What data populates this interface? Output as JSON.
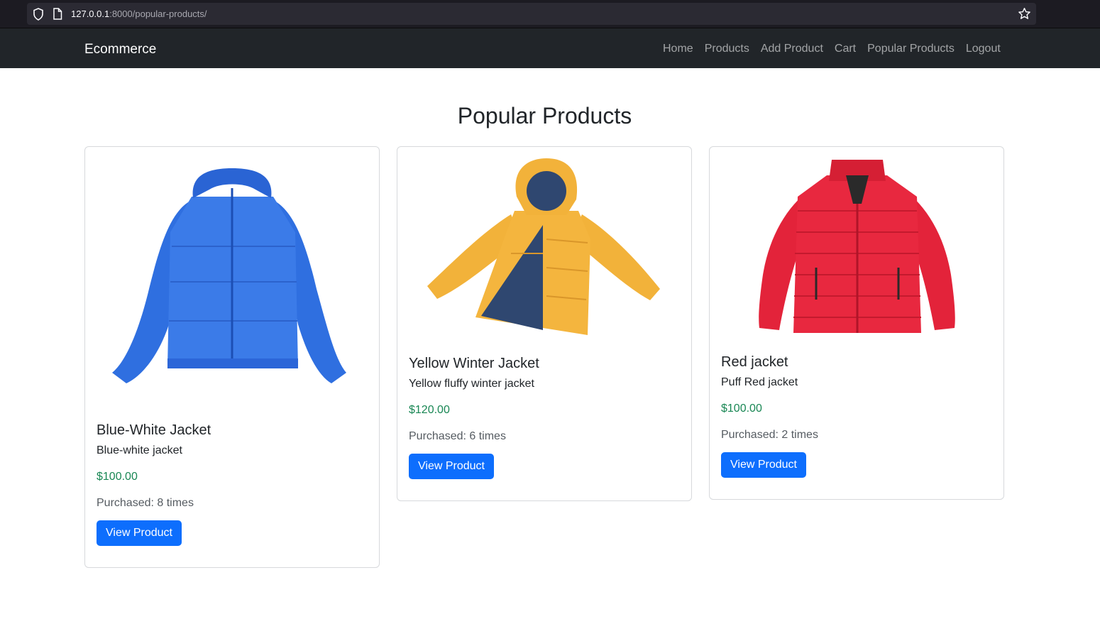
{
  "browser": {
    "url_host": "127.0.0.1",
    "url_path": ":8000/popular-products/"
  },
  "navbar": {
    "brand": "Ecommerce",
    "links": [
      "Home",
      "Products",
      "Add Product",
      "Cart",
      "Popular Products",
      "Logout"
    ]
  },
  "page": {
    "title": "Popular Products"
  },
  "products": [
    {
      "name": "Blue-White Jacket",
      "description": "Blue-white jacket",
      "price": "$100.00",
      "purchased": "Purchased: 8 times",
      "button": "View Product",
      "color": "#2f6fe0"
    },
    {
      "name": "Yellow Winter Jacket",
      "description": "Yellow fluffy winter jacket",
      "price": "$120.00",
      "purchased": "Purchased: 6 times",
      "button": "View Product",
      "color": "#f2b23a"
    },
    {
      "name": "Red jacket",
      "description": "Puff Red jacket",
      "price": "$100.00",
      "purchased": "Purchased: 2 times",
      "button": "View Product",
      "color": "#e3233a"
    }
  ],
  "colors": {
    "navbar_bg": "#212529",
    "primary": "#0d6efd",
    "price": "#198754"
  }
}
